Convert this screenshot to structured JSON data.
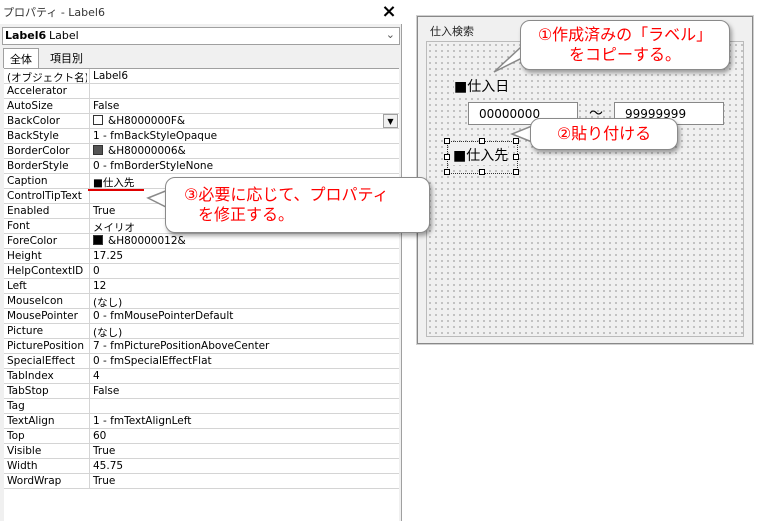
{
  "properties_window": {
    "title": "プロパティ - Label6",
    "close_icon": "×",
    "object_name": "Label6",
    "object_type": "Label",
    "tabs": [
      "全体",
      "項目別"
    ],
    "rows": [
      {
        "name": "(オブジェクト名)",
        "value": "Label6"
      },
      {
        "name": "Accelerator",
        "value": ""
      },
      {
        "name": "AutoSize",
        "value": "False"
      },
      {
        "name": "BackColor",
        "value": "&H8000000F&",
        "swatch": "#ffffff"
      },
      {
        "name": "BackStyle",
        "value": "1 - fmBackStyleOpaque"
      },
      {
        "name": "BorderColor",
        "value": "&H80000006&",
        "swatch": "#555555"
      },
      {
        "name": "BorderStyle",
        "value": "0 - fmBorderStyleNone"
      },
      {
        "name": "Caption",
        "value": "■仕入先"
      },
      {
        "name": "ControlTipText",
        "value": ""
      },
      {
        "name": "Enabled",
        "value": "True"
      },
      {
        "name": "Font",
        "value": "メイリオ"
      },
      {
        "name": "ForeColor",
        "value": "&H80000012&",
        "swatch": "#000000"
      },
      {
        "name": "Height",
        "value": "17.25"
      },
      {
        "name": "HelpContextID",
        "value": "0"
      },
      {
        "name": "Left",
        "value": "12"
      },
      {
        "name": "MouseIcon",
        "value": "(なし)"
      },
      {
        "name": "MousePointer",
        "value": "0 - fmMousePointerDefault"
      },
      {
        "name": "Picture",
        "value": "(なし)"
      },
      {
        "name": "PicturePosition",
        "value": "7 - fmPicturePositionAboveCenter"
      },
      {
        "name": "SpecialEffect",
        "value": "0 - fmSpecialEffectFlat"
      },
      {
        "name": "TabIndex",
        "value": "4"
      },
      {
        "name": "TabStop",
        "value": "False"
      },
      {
        "name": "Tag",
        "value": ""
      },
      {
        "name": "TextAlign",
        "value": "1 - fmTextAlignLeft"
      },
      {
        "name": "Top",
        "value": "60"
      },
      {
        "name": "Visible",
        "value": "True"
      },
      {
        "name": "Width",
        "value": "45.75"
      },
      {
        "name": "WordWrap",
        "value": "True"
      }
    ]
  },
  "userform": {
    "title": "仕入検索",
    "label_date": "■仕入日",
    "textbox_from": "00000000",
    "tilde": "〜",
    "textbox_to": "99999999",
    "label_supplier": "■仕入先"
  },
  "callouts": {
    "step1_line1": "①作成済みの「ラベル」",
    "step1_line2": "をコピーする。",
    "step2": "②貼り付ける",
    "step3_line1": "③必要に応じて、プロパティ",
    "step3_line2": "を修正する。"
  },
  "colors": {
    "callout_text": "#ff0000",
    "caption_underline": "#e00000"
  }
}
